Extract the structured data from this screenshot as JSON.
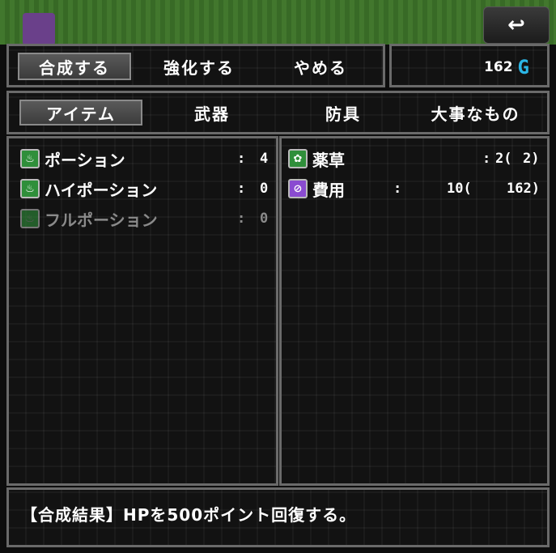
{
  "header": {
    "back_icon": "↩"
  },
  "actions": [
    {
      "label": "合成する",
      "selected": true
    },
    {
      "label": "強化する",
      "selected": false
    },
    {
      "label": "やめる",
      "selected": false
    }
  ],
  "gold": {
    "amount": "162",
    "unit": "G"
  },
  "tabs": [
    {
      "label": "アイテム",
      "selected": true
    },
    {
      "label": "武器",
      "selected": false
    },
    {
      "label": "防具",
      "selected": false
    },
    {
      "label": "大事なもの",
      "selected": false
    }
  ],
  "items": [
    {
      "name": "ポーション",
      "sep": ":",
      "qty": "4",
      "icon": "potion-icon",
      "dim": false
    },
    {
      "name": "ハイポーション",
      "sep": ":",
      "qty": "0",
      "icon": "potion-icon",
      "dim": false
    },
    {
      "name": "フルポーション",
      "sep": ":",
      "qty": "0",
      "icon": "potion-icon",
      "dim": true
    }
  ],
  "materials": [
    {
      "name": "薬草",
      "col1": ":",
      "col2": "2(",
      "col3": "2)",
      "icon": "herb-icon"
    },
    {
      "name": "費用",
      "col1": ":",
      "col2": "10(",
      "col3": "162)",
      "icon": "cost-icon"
    }
  ],
  "description": "【合成結果】HPを500ポイント回復する。",
  "colors": {
    "accent": "#2bb6e6",
    "panel_border": "#6a6a6a",
    "potion_icon": "#2f8f3a",
    "cost_icon": "#8a4bd1"
  }
}
